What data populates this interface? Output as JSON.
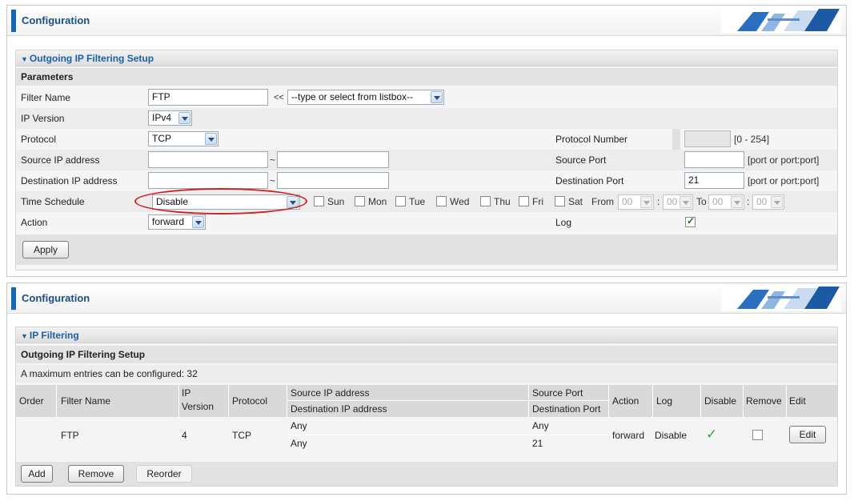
{
  "top": {
    "header_title": "Configuration",
    "section_title": "Outgoing IP Filtering Setup",
    "params_label": "Parameters",
    "filter_name_label": "Filter Name",
    "filter_name_value": "FTP",
    "filter_list_arrow": "<<",
    "filter_list_value": "--type or select from listbox--",
    "ip_version_label": "IP Version",
    "ip_version_value": "IPv4",
    "protocol_label": "Protocol",
    "protocol_value": "TCP",
    "protocol_number_label": "Protocol Number",
    "protocol_number_hint": "[0 - 254]",
    "source_ip_label": "Source IP address",
    "tilde": "~",
    "source_port_label": "Source Port",
    "port_hint": "[port or port:port]",
    "dest_ip_label": "Destination IP address",
    "dest_port_label": "Destination Port",
    "dest_port_value": "21",
    "time_schedule_label": "Time Schedule",
    "time_schedule_value": "Disable",
    "days": [
      "Sun",
      "Mon",
      "Tue",
      "Wed",
      "Thu",
      "Fri",
      "Sat"
    ],
    "from_label": "From",
    "to_label": "To",
    "time_value": "00",
    "colon": ":",
    "action_label": "Action",
    "action_value": "forward",
    "log_label": "Log",
    "log_checked": true,
    "apply_label": "Apply"
  },
  "bottom": {
    "header_title": "Configuration",
    "section_title": "IP Filtering",
    "sub_title": "Outgoing IP Filtering Setup",
    "max_entries": "A maximum entries can be configured: 32",
    "columns": {
      "order": "Order",
      "filter_name": "Filter Name",
      "ip_version_1": "IP",
      "ip_version_2": "Version",
      "protocol": "Protocol",
      "source_ip": "Source IP address",
      "dest_ip": "Destination IP address",
      "source_port": "Source Port",
      "dest_port": "Destination Port",
      "action": "Action",
      "log": "Log",
      "disable": "Disable",
      "remove": "Remove",
      "edit": "Edit"
    },
    "row": {
      "order": "",
      "filter_name": "FTP",
      "ip_version": "4",
      "protocol": "TCP",
      "source_ip": "Any",
      "dest_ip": "Any",
      "source_port": "Any",
      "dest_port": "21",
      "action": "forward",
      "log": "Disable",
      "disabled": true,
      "edit_label": "Edit"
    },
    "add_label": "Add",
    "remove_label": "Remove",
    "reorder_label": "Reorder"
  }
}
